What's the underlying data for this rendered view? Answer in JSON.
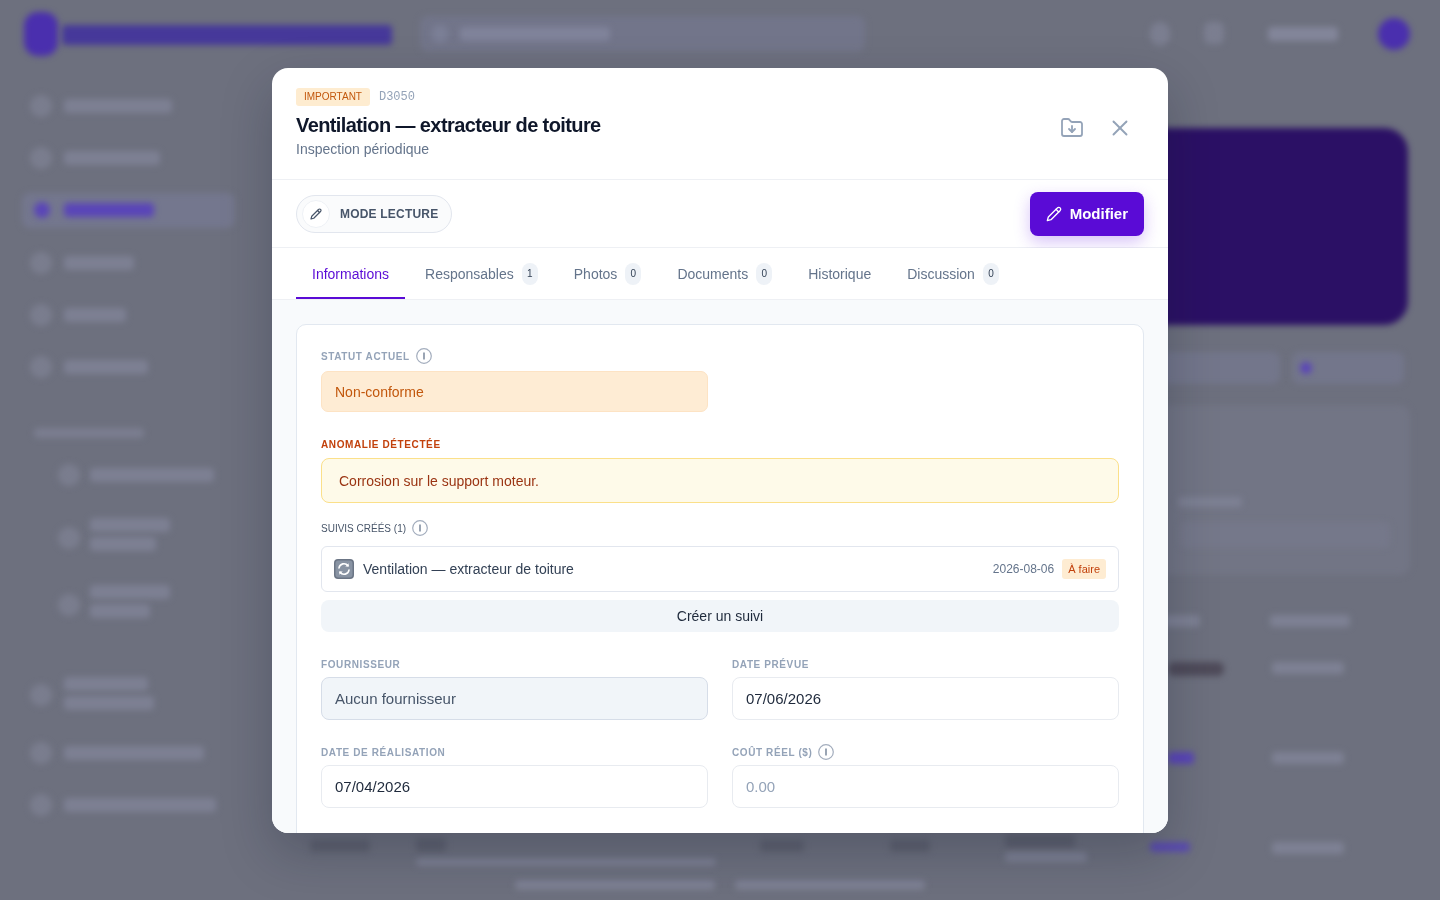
{
  "modal": {
    "priority": "IMPORTANT",
    "code": "D3050",
    "title": "Ventilation — extracteur de toiture",
    "subtitle": "Inspection périodique",
    "mode_button": "MODE LECTURE",
    "edit_button": "Modifier"
  },
  "tabs": [
    {
      "label": "Informations",
      "selected": true
    },
    {
      "label": "Responsables",
      "count": "1",
      "selected": false
    },
    {
      "label": "Photos",
      "count": "0",
      "selected": false
    },
    {
      "label": "Documents",
      "count": "0",
      "selected": false
    },
    {
      "label": "Historique",
      "selected": false
    },
    {
      "label": "Discussion",
      "count": "0",
      "selected": false
    }
  ],
  "status": {
    "label": "STATUT ACTUEL",
    "info": true,
    "value": "Non-conforme"
  },
  "anomaly": {
    "label": "ANOMALIE DÉTECTÉE",
    "text": "Corrosion sur le support moteur."
  },
  "follow_ups": {
    "label": "SUIVIS CRÉÉS (1)",
    "info": true,
    "items": [
      {
        "title": "Ventilation — extracteur de toiture",
        "date": "2026-08-06",
        "status": "À faire"
      }
    ],
    "create_button": "Créer un suivi"
  },
  "fields": [
    {
      "label": "FOURNISSEUR",
      "info": false,
      "value": "Aucun fournisseur",
      "disabled": true
    },
    {
      "label": "DATE PRÉVUE",
      "info": false,
      "value": "07/06/2026",
      "disabled": false
    },
    {
      "label": "DATE DE RÉALISATION",
      "info": false,
      "value": "07/04/2026",
      "disabled": false
    },
    {
      "label": "COÛT RÉEL ($)",
      "info": true,
      "placeholder": "0.00",
      "disabled": false
    }
  ]
}
